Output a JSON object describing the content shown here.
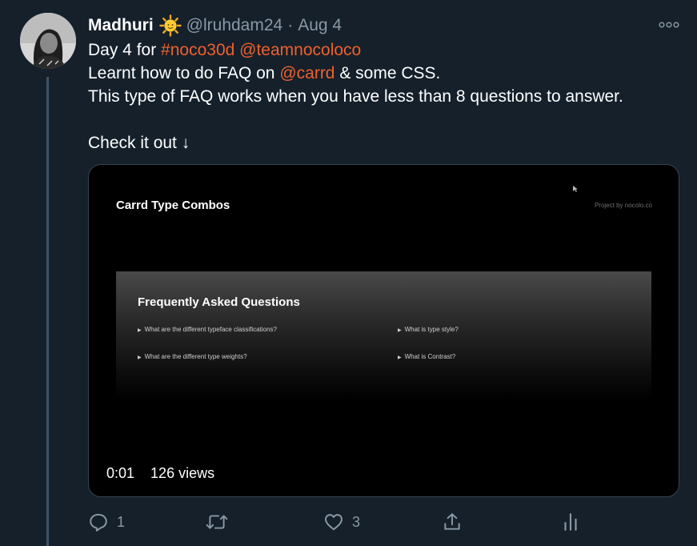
{
  "tweet": {
    "author_name": "Madhuri",
    "handle": "@lruhdam24",
    "separator": "·",
    "date": "Aug 4",
    "lines": [
      [
        {
          "t": "Day 4 for ",
          "link": false
        },
        {
          "t": "#noco30d",
          "link": true
        },
        {
          "t": " ",
          "link": false
        },
        {
          "t": "@teamnocoloco",
          "link": true
        }
      ],
      [
        {
          "t": "Learnt how to do FAQ on ",
          "link": false
        },
        {
          "t": "@carrd",
          "link": true
        },
        {
          "t": " & some CSS.",
          "link": false
        }
      ],
      [
        {
          "t": "This type of FAQ works when you have less than 8 questions to answer.",
          "link": false
        }
      ],
      [],
      [
        {
          "t": "Check it out ↓",
          "link": false
        }
      ]
    ]
  },
  "media": {
    "video_title": "Carrd Type Combos",
    "credit": "Project by nocolo.co",
    "faq": {
      "title": "Frequently Asked Questions",
      "questions": [
        "What are the different typeface classifications?",
        "What is type style?",
        "What are the different type weights?",
        "What is Contrast?"
      ]
    },
    "time": "0:01",
    "views": "126 views"
  },
  "actions": {
    "reply_count": "1",
    "retweet_count": "",
    "like_count": "3"
  },
  "colors": {
    "background": "#15202b",
    "link": "#f0602c",
    "muted": "#8899a6"
  },
  "icons": [
    "sun-emoji-icon",
    "more-icon",
    "reply-icon",
    "retweet-icon",
    "like-icon",
    "share-icon",
    "analytics-icon"
  ]
}
